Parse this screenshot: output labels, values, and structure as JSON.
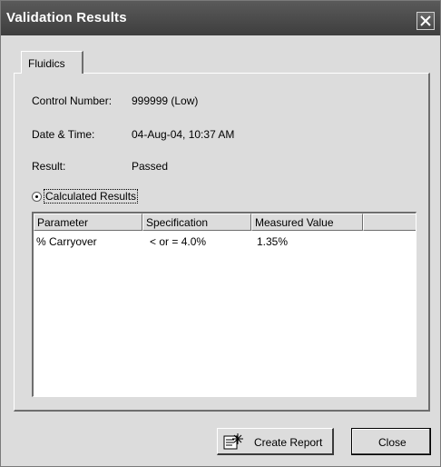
{
  "window": {
    "title": "Validation Results"
  },
  "tabs": [
    {
      "label": "Fluidics"
    }
  ],
  "fields": {
    "control_number": {
      "label": "Control Number:",
      "value": "999999 (Low)"
    },
    "date_time": {
      "label": "Date & Time:",
      "value": "04-Aug-04, 10:37 AM"
    },
    "result": {
      "label": "Result:",
      "value": "Passed"
    }
  },
  "radio": {
    "label": "Calculated Results",
    "selected": true
  },
  "table": {
    "columns": [
      "Parameter",
      "Specification",
      "Measured Value",
      ""
    ],
    "rows": [
      [
        "% Carryover",
        "< or = 4.0%",
        "1.35%"
      ]
    ]
  },
  "buttons": {
    "create_report": "Create Report",
    "close": "Close"
  },
  "icons": {
    "title_close": "close-icon",
    "report": "report-icon",
    "radio": "radio-icon"
  },
  "colors": {
    "titlebar": "#474747",
    "face": "#dcdcdc",
    "list_bg": "#ffffff"
  }
}
